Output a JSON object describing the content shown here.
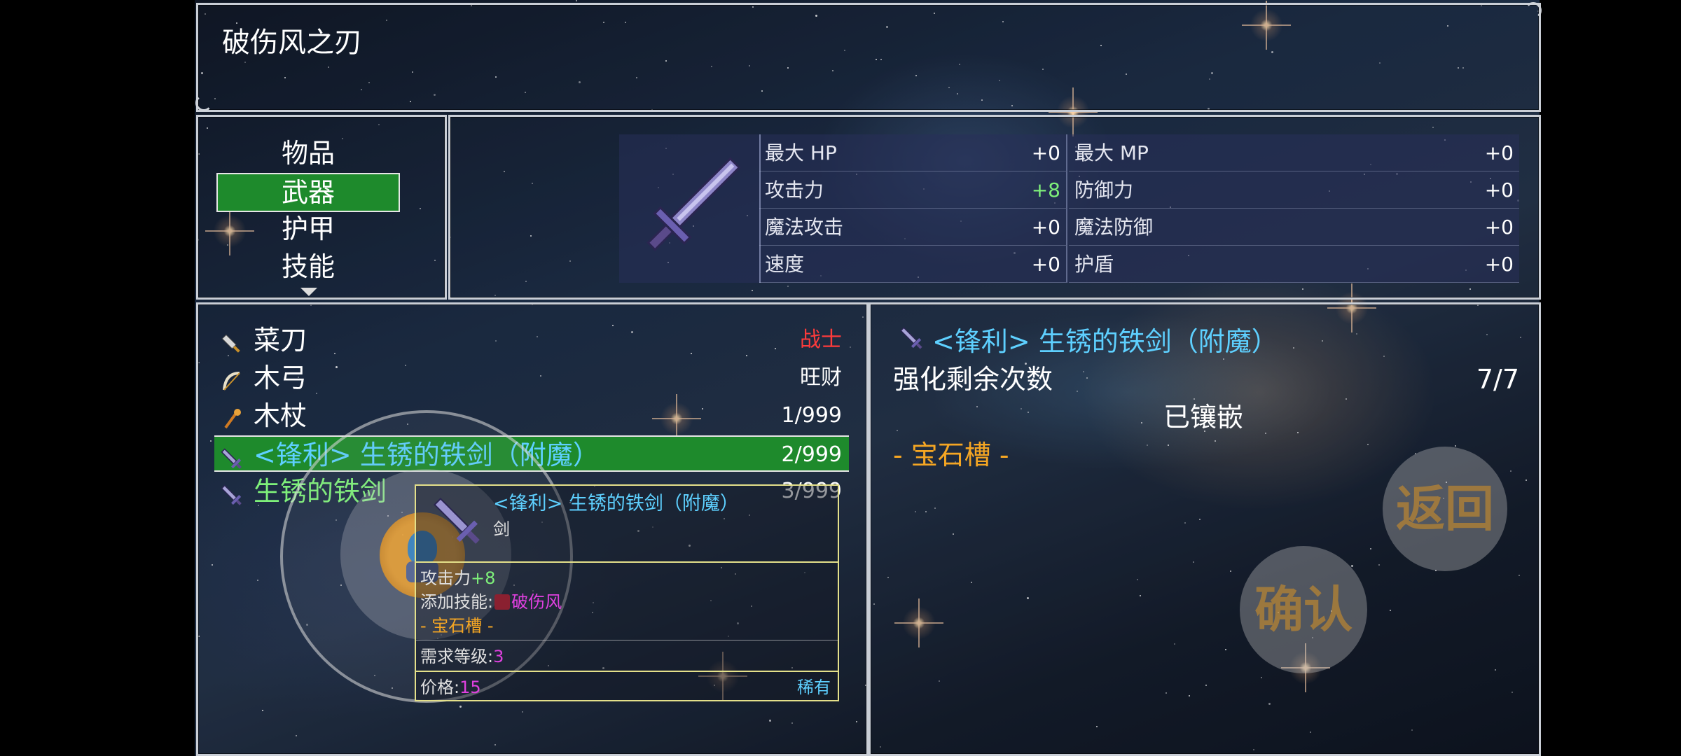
{
  "skill_title": "破伤风之刃",
  "categories": [
    {
      "label": "物品",
      "selected": false
    },
    {
      "label": "武器",
      "selected": true
    },
    {
      "label": "护甲",
      "selected": false
    },
    {
      "label": "技能",
      "selected": false
    }
  ],
  "stats": [
    {
      "label": "最大 HP",
      "value": "+0"
    },
    {
      "label": "最大 MP",
      "value": "+0"
    },
    {
      "label": "攻击力",
      "value": "+8",
      "value_color": "#7ef07a"
    },
    {
      "label": "防御力",
      "value": "+0"
    },
    {
      "label": "魔法攻击",
      "value": "+0"
    },
    {
      "label": "魔法防御",
      "value": "+0"
    },
    {
      "label": "速度",
      "value": "+0"
    },
    {
      "label": "护盾",
      "value": "+0"
    }
  ],
  "items": [
    {
      "name": "菜刀",
      "right": "战士",
      "right_color": "#ff3b3b",
      "name_color": "#ffffff",
      "icon": "cleaver-icon",
      "selected": false
    },
    {
      "name": "木弓",
      "right": "旺财",
      "right_color": "#ffffff",
      "name_color": "#ffffff",
      "icon": "bow-icon",
      "selected": false
    },
    {
      "name": "木杖",
      "right": "1/999",
      "right_color": "#ffffff",
      "name_color": "#ffffff",
      "icon": "staff-icon",
      "selected": false
    },
    {
      "name": "<锋利> 生锈的铁剑（附魔）",
      "right": "2/999",
      "right_color": "#ffffff",
      "name_color": "#5ed0ff",
      "icon": "sword-icon",
      "selected": true
    },
    {
      "name": "生锈的铁剑",
      "right": "3/999",
      "right_color": "#ffffff",
      "name_color": "#7ef07a",
      "icon": "sword-icon",
      "selected": false
    }
  ],
  "tooltip": {
    "name": "<锋利> 生锈的铁剑（附魔）",
    "type": "剑",
    "attack_label": "攻击力",
    "attack_value": "+8",
    "skill_label": "添加技能:",
    "skill_name": "破伤风",
    "gem_slot": "- 宝石槽 -",
    "req_label": "需求等级:",
    "req_value": "3",
    "price_label": "价格:",
    "price_value": "15",
    "rarity": "稀有"
  },
  "detail": {
    "name": "<锋利> 生锈的铁剑（附魔）",
    "enhance_label": "强化剩余次数",
    "enhance_value": "7/7",
    "inlaid_label": "已镶嵌",
    "gem_slot": "- 宝石槽 -"
  },
  "buttons": {
    "back": "返回",
    "confirm": "确认"
  },
  "colors": {
    "selection": "#1e8a2c",
    "gem_orange": "#f5a623",
    "item_blue": "#5ed0ff",
    "tooltip_border": "#e4e08a",
    "magenta": "#e040e0"
  }
}
